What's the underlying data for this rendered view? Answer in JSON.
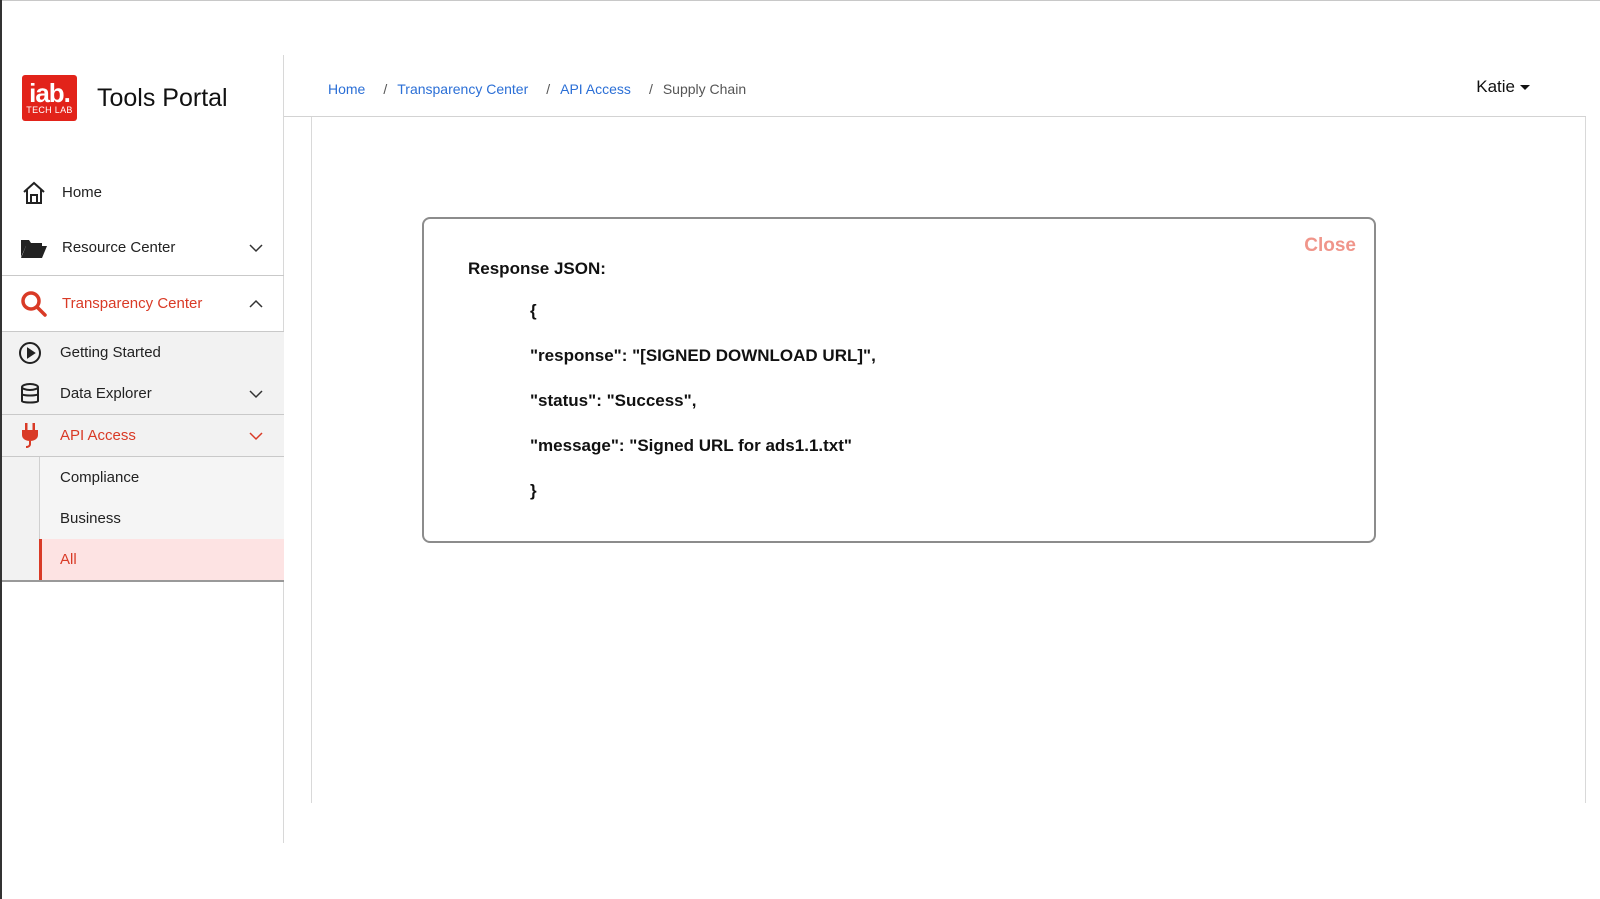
{
  "brand": {
    "logo_top": "iab.",
    "logo_bottom": "TECH LAB",
    "title": "Tools Portal"
  },
  "sidebar": {
    "home": "Home",
    "resource_center": "Resource Center",
    "transparency_center": "Transparency Center",
    "getting_started": "Getting Started",
    "data_explorer": "Data Explorer",
    "api_access": "API Access",
    "compliance": "Compliance",
    "business": "Business",
    "all": "All"
  },
  "breadcrumb": {
    "home": "Home",
    "transparency_center": "Transparency Center",
    "api_access": "API Access",
    "current": "Supply Chain",
    "separator": "/"
  },
  "user": {
    "name": "Katie"
  },
  "modal": {
    "close_label": "Close",
    "title": "Response JSON:",
    "lines": [
      "{",
      "\"response\": \"[SIGNED DOWNLOAD URL]\",",
      "\"status\": \"Success\",",
      "\"message\": \"Signed URL for ads1.1.txt\"",
      "}"
    ]
  },
  "colors": {
    "accent": "#d93a26",
    "link": "#2b6fd6",
    "close": "#f0958a",
    "selected_bg": "#fde3e3"
  }
}
